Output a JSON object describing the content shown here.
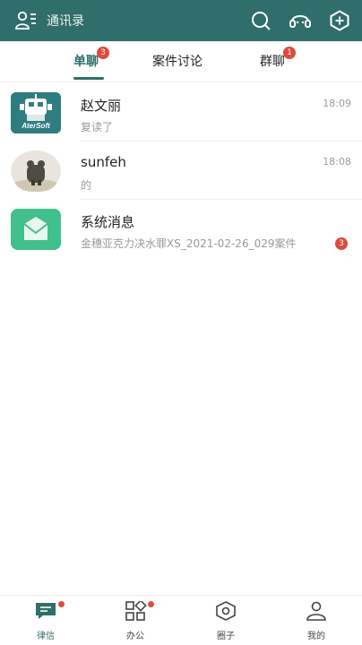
{
  "header": {
    "contacts_label": "通讯录",
    "icons": [
      "contacts-icon",
      "search-icon",
      "customer-service-icon",
      "add-icon"
    ]
  },
  "tabs": [
    {
      "label": "单聊",
      "badge": "3",
      "active": true
    },
    {
      "label": "案件讨论",
      "badge": "",
      "active": false
    },
    {
      "label": "群聊",
      "badge": "1",
      "active": false
    }
  ],
  "conversations": [
    {
      "name": "赵文丽",
      "preview": "复读了",
      "time": "18:09",
      "avatar_text": "AterSoft",
      "badge": ""
    },
    {
      "name": "sunfeh",
      "preview": "的",
      "time": "18:08",
      "avatar_text": "",
      "badge": ""
    },
    {
      "name": "系统消息",
      "preview": "金穗亚克力决水罪XS_2021-02-26_029案件",
      "time": "",
      "avatar_text": "",
      "badge": "3"
    }
  ],
  "bottom_nav": [
    {
      "label": "律信",
      "active": true,
      "dot": true
    },
    {
      "label": "办公",
      "active": false,
      "dot": true
    },
    {
      "label": "圈子",
      "active": false,
      "dot": false
    },
    {
      "label": "我的",
      "active": false,
      "dot": false
    }
  ],
  "colors": {
    "primary": "#2f6e6a",
    "badge": "#e04a3c",
    "system_avatar": "#3ebf8a"
  }
}
